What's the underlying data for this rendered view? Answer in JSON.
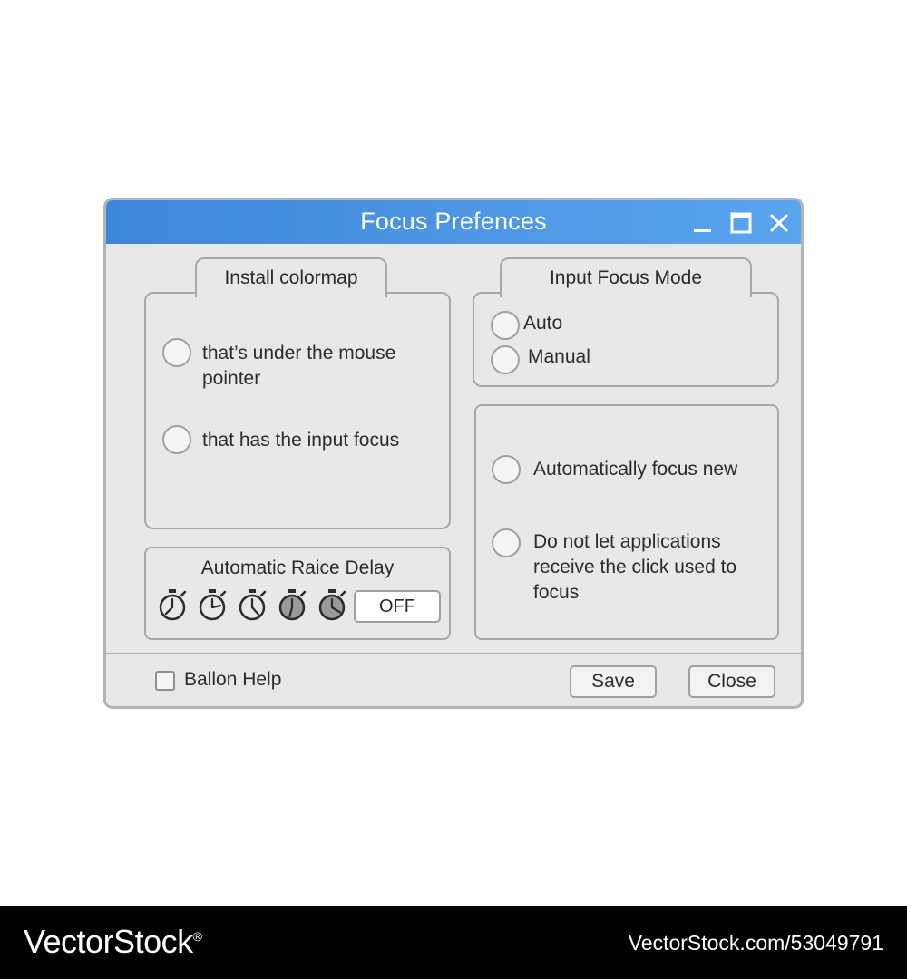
{
  "window": {
    "title": "Focus Prefences",
    "controls": {
      "minimize": "minimize-icon",
      "maximize": "maximize-icon",
      "close": "close-icon"
    }
  },
  "colormap": {
    "title": "Install colormap",
    "options": [
      {
        "label": "that’s under the mouse pointer",
        "selected": false
      },
      {
        "label": "that has the input focus",
        "selected": false
      }
    ]
  },
  "focus_mode": {
    "title": "Input Focus Mode",
    "options": [
      {
        "label": "Auto",
        "selected": false
      },
      {
        "label": "Manual",
        "selected": false
      }
    ]
  },
  "new_windows": {
    "options": [
      {
        "label": "Automatically focus new",
        "selected": false
      },
      {
        "label": "Do not let applications receive the click used to focus",
        "selected": false
      }
    ]
  },
  "raise_delay": {
    "title": "Automatic Raice Delay",
    "icon": "stopwatch-icon",
    "icon_count": 5,
    "value": "OFF"
  },
  "footer": {
    "balloon_help": {
      "label": "Ballon Help",
      "checked": false
    },
    "save_label": "Save",
    "close_label": "Close"
  },
  "watermark": {
    "brand": "VectorStock",
    "brand_mark": "®",
    "image_id": "VectorStock.com/53049791"
  },
  "colors": {
    "titlebar_start": "#3d86d9",
    "titlebar_end": "#5aa5ee",
    "panel": "#e8e8e8",
    "border": "#a8a8a8"
  }
}
